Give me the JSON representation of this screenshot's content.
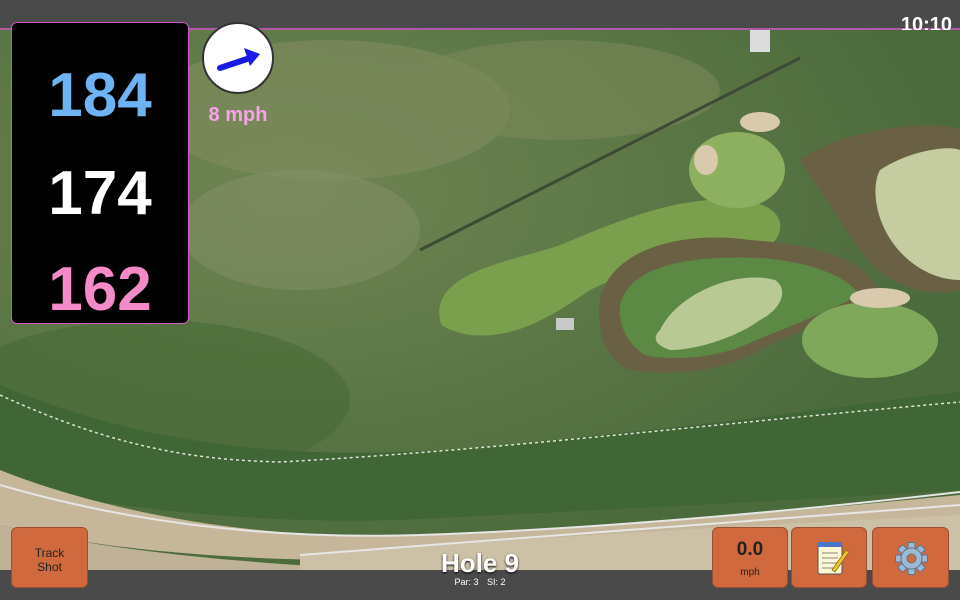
{
  "status": {
    "time": "10:10"
  },
  "distances": {
    "back": "184",
    "middle": "174",
    "front": "162"
  },
  "wind": {
    "speed_label": "8 mph",
    "arrow_color": "#1a1ae6"
  },
  "buttons": {
    "track_line1": "Track",
    "track_line2": "Shot",
    "speed_value": "0.0",
    "speed_unit": "mph"
  },
  "hole": {
    "title": "Hole 9",
    "par": "Par: 3",
    "si": "SI: 2"
  },
  "icons": {
    "notes": "notepad-icon",
    "settings": "gear-icon",
    "wind": "wind-arrow-icon"
  },
  "colors": {
    "back": "#6eb4f5",
    "middle": "#ffffff",
    "front": "#f58ac8",
    "button": "#d0693d"
  }
}
